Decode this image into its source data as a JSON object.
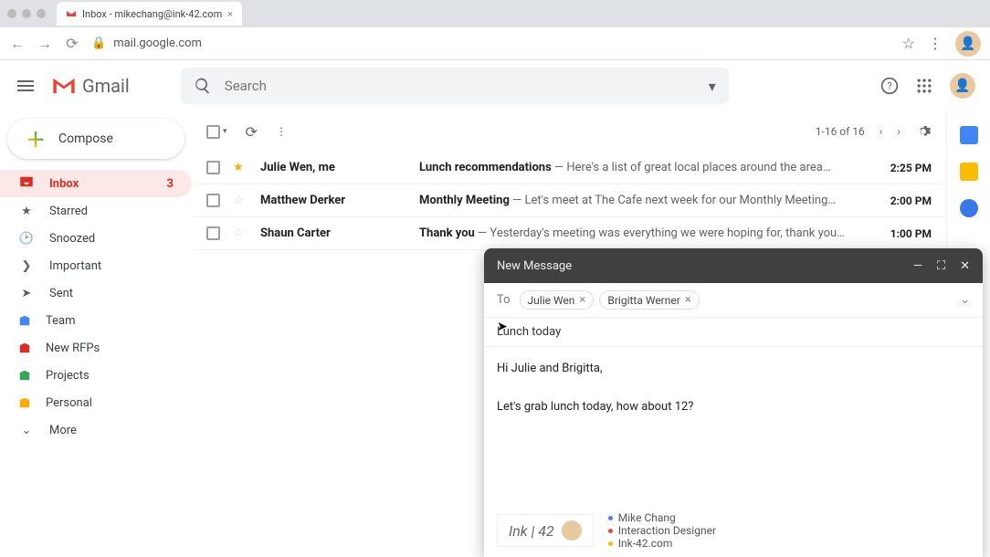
{
  "browser": {
    "tab_title": "Inbox - mikechang@ink-42.com",
    "url": "mail.google.com"
  },
  "header": {
    "product": "Gmail",
    "search_placeholder": "Search"
  },
  "sidebar": {
    "compose": "Compose",
    "items": [
      {
        "icon": "inbox",
        "label": "Inbox",
        "count": "3",
        "active": true
      },
      {
        "icon": "star",
        "label": "Starred"
      },
      {
        "icon": "clock",
        "label": "Snoozed"
      },
      {
        "icon": "important",
        "label": "Important"
      },
      {
        "icon": "send",
        "label": "Sent"
      },
      {
        "icon": "label",
        "label": "Team",
        "color": "#4285f4"
      },
      {
        "icon": "label",
        "label": "New RFPs",
        "color": "#d93025"
      },
      {
        "icon": "label",
        "label": "Projects",
        "color": "#34a853"
      },
      {
        "icon": "label",
        "label": "Personal",
        "color": "#f9ab00"
      },
      {
        "icon": "more",
        "label": "More"
      }
    ]
  },
  "toolbar": {
    "page_info": "1-16 of 16"
  },
  "rows": [
    {
      "starred": true,
      "from": "Julie Wen, me",
      "subject": "Lunch recommendations",
      "snippet": " — Here's a list of great local places around the area…",
      "time": "2:25 PM"
    },
    {
      "starred": false,
      "from": "Matthew Derker",
      "subject": "Monthly Meeting",
      "snippet": " — Let's meet at The Cafe next week for our Monthly Meeting…",
      "time": "2:00 PM"
    },
    {
      "starred": false,
      "from": "Shaun Carter",
      "subject": "Thank you",
      "snippet": " — Yesterday's meeting was everything we were hoping for, thank you…",
      "time": "1:00 PM"
    }
  ],
  "compose_win": {
    "title": "New Message",
    "to_label": "To",
    "recipients": [
      "Julie Wen",
      "Brigitta Werner"
    ],
    "subject": "Lunch today",
    "body_line1": "Hi Julie and Brigitta,",
    "body_line2": "Let's grab lunch today, how about 12?",
    "sig_brand": "Ink | 42",
    "sig_name": "Mike Chang",
    "sig_title": "Interaction Designer",
    "sig_site": "Ink-42.com"
  }
}
